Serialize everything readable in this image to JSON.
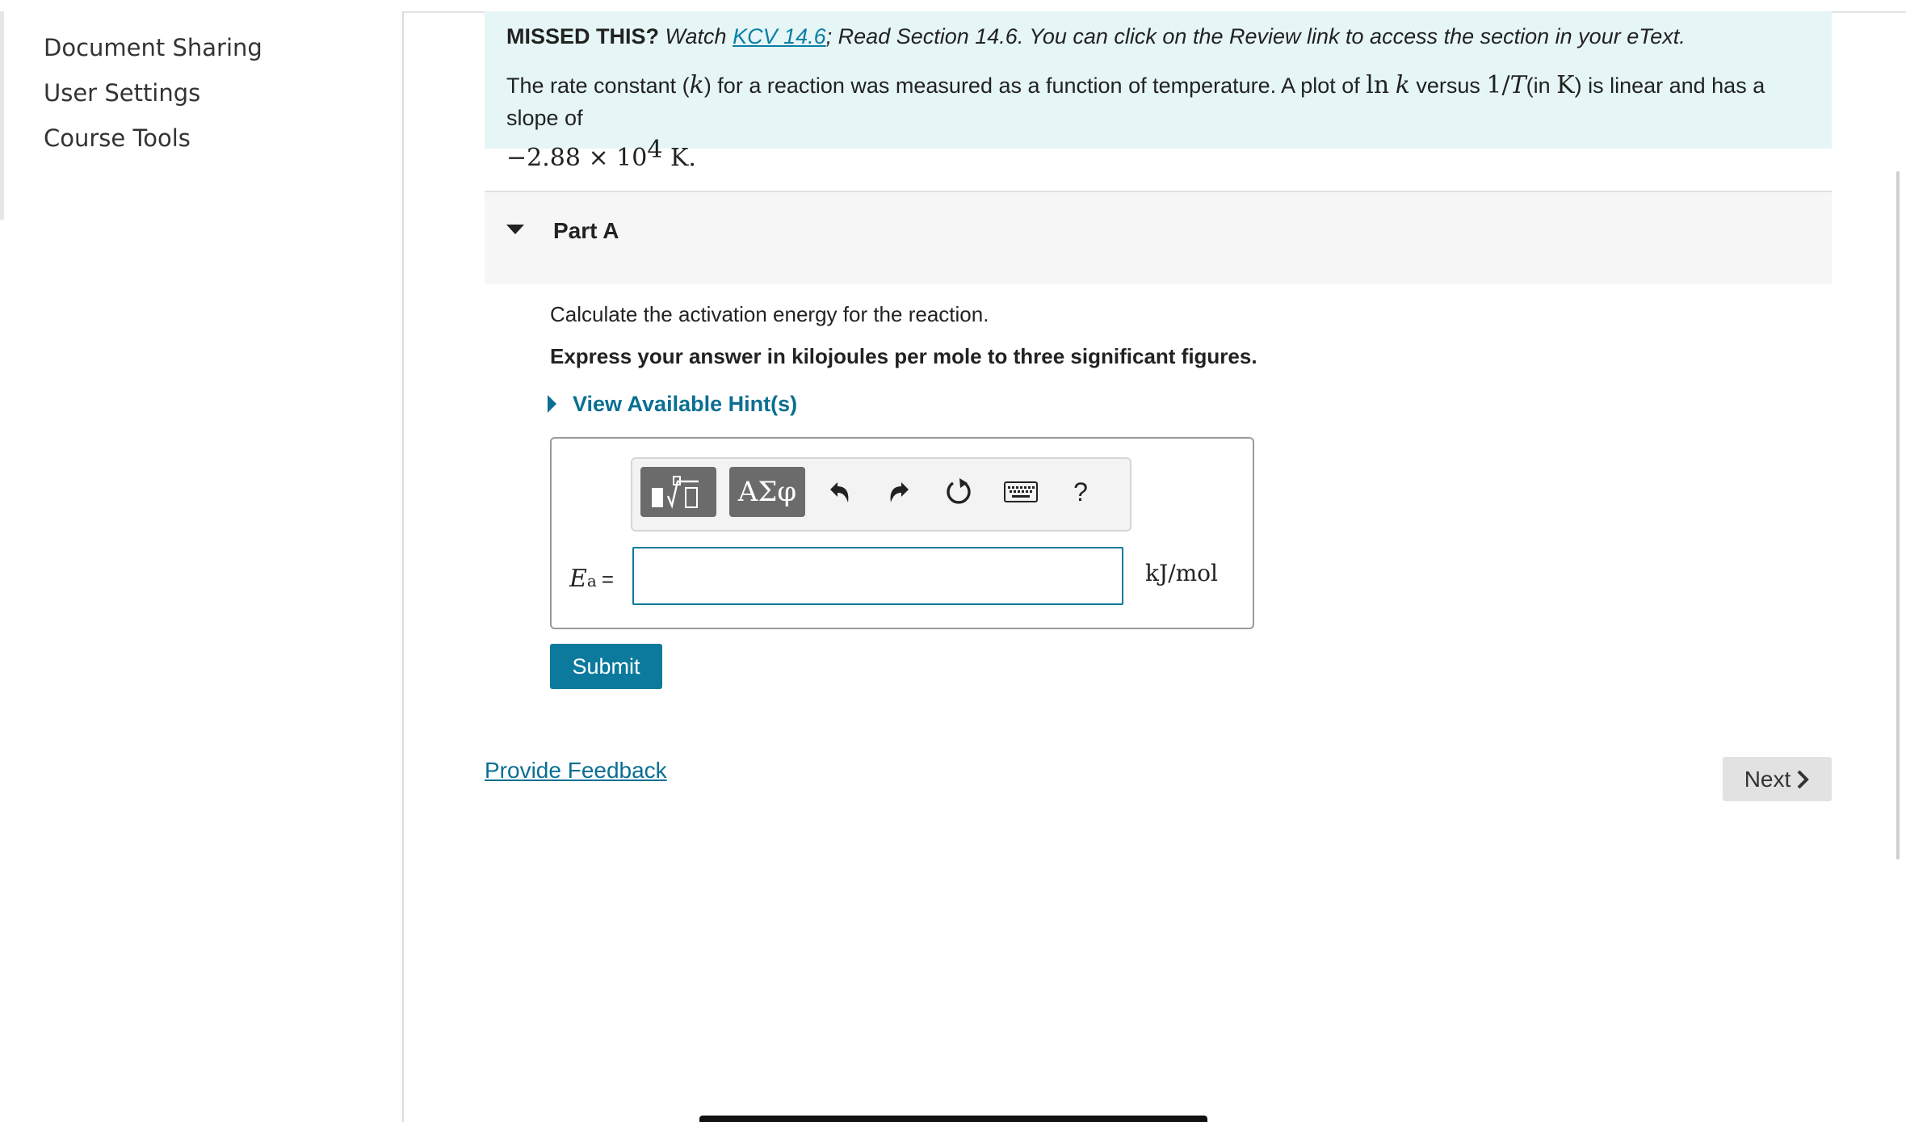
{
  "sidebar": {
    "items": [
      {
        "label": "Document Sharing"
      },
      {
        "label": "User Settings"
      },
      {
        "label": "Course Tools"
      }
    ]
  },
  "missed": {
    "bold_label": "MISSED THIS?",
    "watch_text": "Watch",
    "link_text": "KCV 14.6",
    "rest_text": "; Read Section 14.6. You can click on the Review link to access the section in your eText.",
    "problem": {
      "t1": "The rate constant (",
      "k": "k",
      "t2": ") for a reaction was measured as a function of temperature. A plot of ",
      "ln": "ln",
      "k2": "k",
      "t3": " versus ",
      "one_over": "1/",
      "T": "T",
      "t4": "(in ",
      "K_unit": "K",
      "t5": ") is linear and has a slope of",
      "slope_mantissa": "−2.88 × 10",
      "slope_exp": "4",
      "slope_unit": " K."
    }
  },
  "part": {
    "title": "Part A",
    "question": "Calculate the activation energy for the reaction.",
    "instruction": "Express your answer in kilojoules per mole to three significant figures.",
    "hint_label": "View Available Hint(s)"
  },
  "toolbar": {
    "greek_label": "ΑΣφ",
    "help_label": "?",
    "icons": [
      "templates-icon",
      "greek-symbols-icon",
      "undo-icon",
      "redo-icon",
      "reset-icon",
      "keyboard-icon",
      "help-icon"
    ]
  },
  "answer": {
    "variable": "E",
    "variable_sub": "a",
    "equals": "=",
    "value": "",
    "units": "kJ/mol"
  },
  "actions": {
    "submit_label": "Submit",
    "feedback_label": "Provide Feedback",
    "next_label": "Next"
  },
  "colors": {
    "accent": "#0b7a9c",
    "link": "#0a6f92",
    "banner_bg": "#e6f6f6"
  }
}
